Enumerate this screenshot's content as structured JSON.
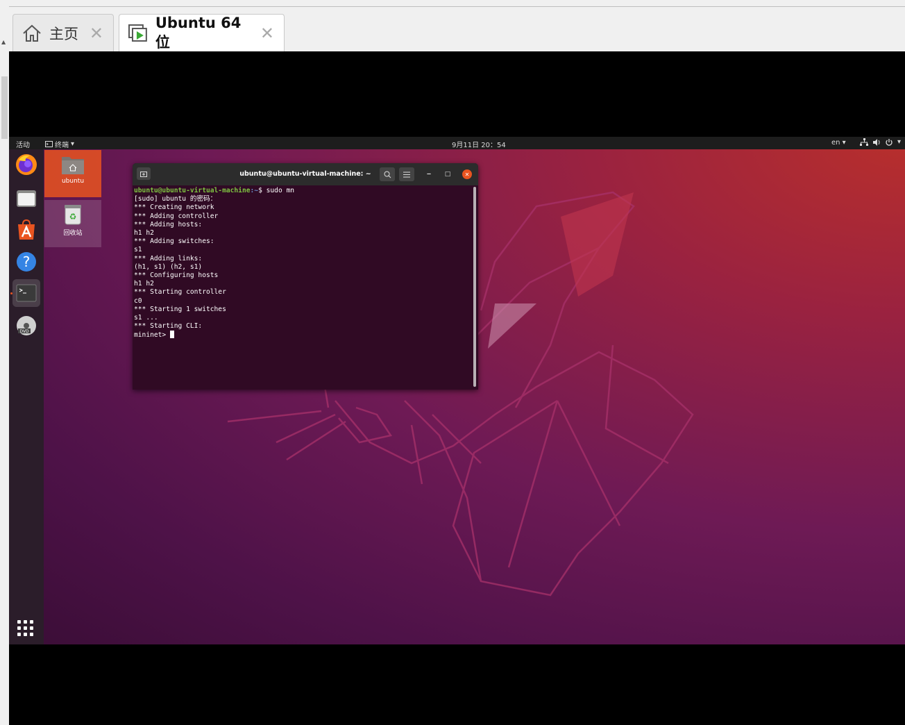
{
  "host": {
    "tabs": [
      {
        "label": "主页",
        "icon": "home-icon",
        "active": false
      },
      {
        "label": "Ubuntu 64 位",
        "icon": "vm-play-icon",
        "active": true
      }
    ]
  },
  "gnome": {
    "activities": "活动",
    "app_menu": "终端",
    "clock": "9月11日 20：54",
    "lang": "en"
  },
  "dock": {
    "items": [
      "firefox-icon",
      "files-icon",
      "software-center-icon",
      "help-icon",
      "terminal-icon",
      "dvd-icon"
    ],
    "active": "terminal-icon"
  },
  "desktop": {
    "home_label": "ubuntu",
    "trash_label": "回收站"
  },
  "terminal": {
    "title": "ubuntu@ubuntu-virtual-machine: ~",
    "prompt_user": "ubuntu@ubuntu-virtual-machine",
    "prompt_path": ":~",
    "prompt_cmd": "$ sudo mn",
    "lines": [
      "[sudo] ubuntu 的密码：",
      "*** Creating network",
      "*** Adding controller",
      "*** Adding hosts:",
      "h1 h2",
      "*** Adding switches:",
      "s1",
      "*** Adding links:",
      "(h1, s1) (h2, s1)",
      "*** Configuring hosts",
      "h1 h2",
      "*** Starting controller",
      "c0",
      "*** Starting 1 switches",
      "s1 ...",
      "*** Starting CLI:"
    ],
    "current_prompt": "mininet> "
  },
  "colors": {
    "ubuntu_orange": "#e95420",
    "terminal_bg": "#300a24"
  }
}
